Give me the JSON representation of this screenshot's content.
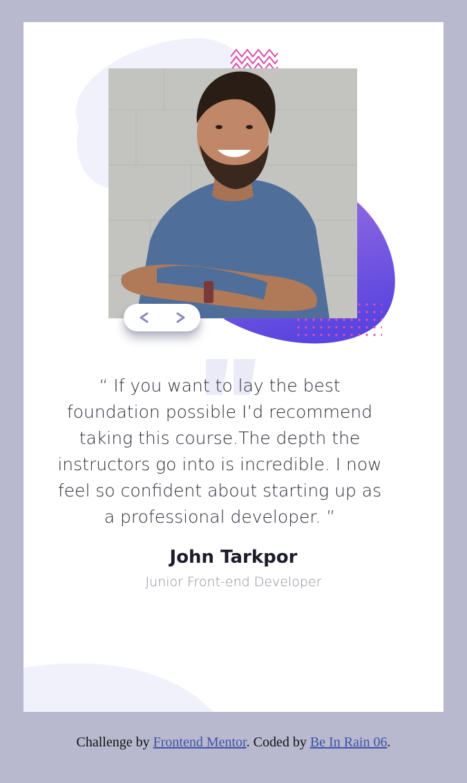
{
  "testimonial": {
    "quote": "“ If you want to lay the best foundation possible I’d recommend taking this course.The depth the instructors go into is incredible. I now feel so confident about starting up as a professional developer. ”",
    "name": "John Tarkpor",
    "role": "Junior Front-end Developer"
  },
  "navigation": {
    "prev_icon": "chevron-left-icon",
    "next_icon": "chevron-right-icon"
  },
  "footer": {
    "prefix": "Challenge by ",
    "link1": "Frontend Mentor",
    "middle": ". Coded by ",
    "link2": "Be In Rain 06",
    "suffix": "."
  },
  "colors": {
    "page_bg": "#b8b8cf",
    "card_bg": "#ffffff",
    "accent_purple": "#6a4fdc",
    "accent_pink": "#e24fa0",
    "blob_light": "#f1f1fb",
    "chevron": "#8a8ab8"
  }
}
